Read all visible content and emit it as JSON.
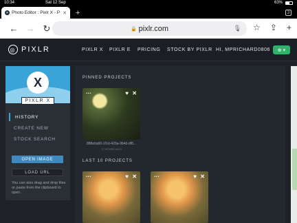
{
  "status_bar": {
    "time": "10:34",
    "date": "Sat 12 Sep",
    "battery": "63%"
  },
  "browser": {
    "tab_title": "Photo Editor : Pixlr X - P",
    "url": "pixlr.com",
    "tab_count": "3"
  },
  "header": {
    "logo": "PIXLR",
    "nav": [
      "PIXLR X",
      "PIXLR E",
      "PRICING",
      "STOCK BY PIXLR",
      "HI, MPRICHARD0806"
    ]
  },
  "sidebar": {
    "app_name": "PIXLR X",
    "items": [
      {
        "label": "HISTORY",
        "active": true
      },
      {
        "label": "CREATE NEW",
        "active": false
      },
      {
        "label": "STOCK SEARCH",
        "active": false
      }
    ],
    "open_button": "OPEN IMAGE",
    "load_button": "LOAD URL",
    "help_text": "You can also drag and drop files or paste from the clipboard to open."
  },
  "main": {
    "pinned_heading": "PINNED PROJECTS",
    "pinned": [
      {
        "name": "888eba90-1f1d-420a-9b4d-df8...",
        "time": "17 HOURS AGO"
      }
    ],
    "last_heading": "LAST 10 PROJECTS"
  },
  "colors": {
    "accent": "#3aa3d7",
    "header_bg": "#1b1f25",
    "button_blue": "#3e89c0",
    "globe_green": "#2db36a"
  },
  "icons": [
    "lock-icon",
    "mic-icon",
    "star-icon",
    "share-icon",
    "add-icon",
    "heart-icon",
    "close-icon",
    "more-icon",
    "globe-icon"
  ]
}
